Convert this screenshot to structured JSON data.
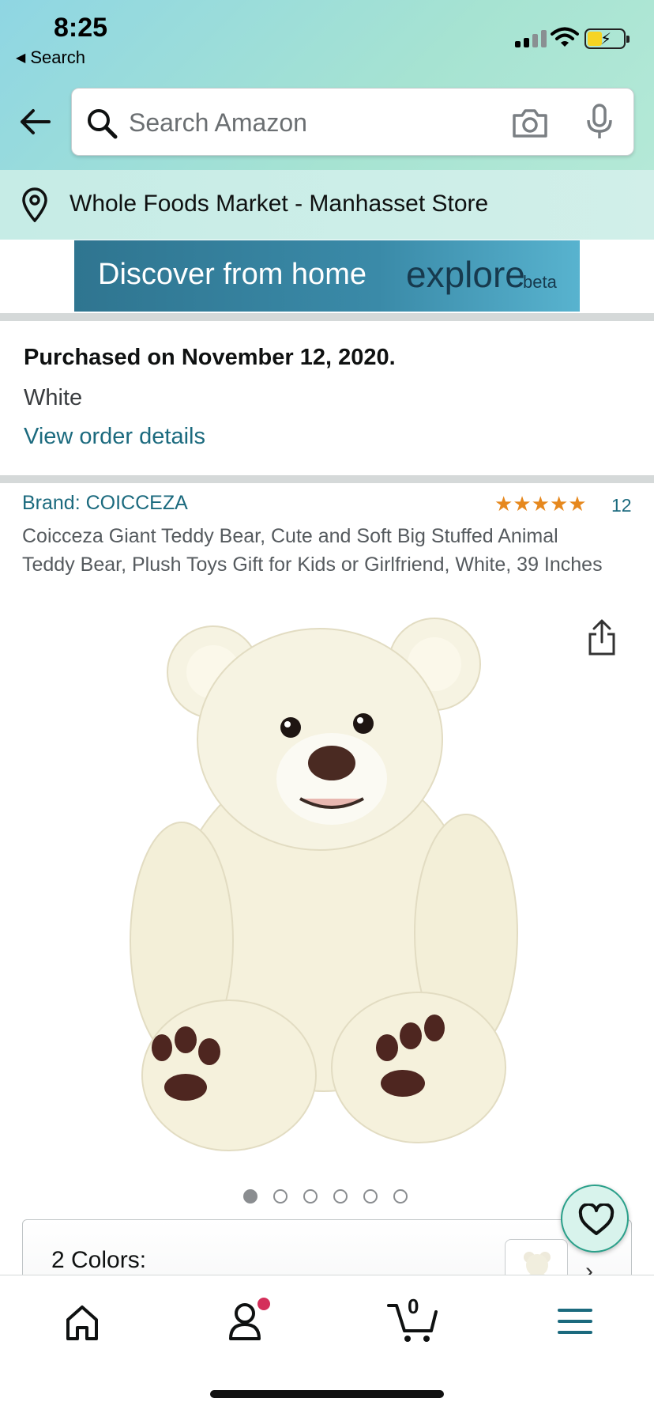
{
  "status_bar": {
    "time": "8:25",
    "back_app_label": "Search",
    "back_app_icon": "triangle-left-icon"
  },
  "search": {
    "placeholder": "Search Amazon",
    "icons": [
      "back-arrow-icon",
      "search-icon",
      "camera-icon",
      "microphone-icon"
    ]
  },
  "location": {
    "text": "Whole Foods Market - Manhasset Store",
    "icon": "location-pin-icon"
  },
  "banner": {
    "discover": "Discover from home",
    "explore": "explore",
    "beta": "beta"
  },
  "purchase": {
    "date_text": "Purchased on November 12, 2020.",
    "color": "White",
    "link": "View order details"
  },
  "product": {
    "brand": "Brand: COICCEZA",
    "rating_stars": 5,
    "rating_count": "12",
    "title": "Coicceza Giant Teddy Bear, Cute and Soft Big Stuffed Animal Teddy Bear, Plush Toys Gift for Kids or Girlfriend, White, 39 Inches",
    "image_count": 6,
    "active_image": 1,
    "colors_label": "2 Colors:"
  },
  "bottom_nav": {
    "items": [
      "home-icon",
      "account-icon",
      "cart-icon",
      "menu-icon"
    ],
    "cart_count": "0"
  },
  "colors": {
    "accent_link": "#1b6a7e",
    "star": "#e6881e",
    "banner": "#2f7590",
    "notification_dot": "#d42f5a"
  }
}
